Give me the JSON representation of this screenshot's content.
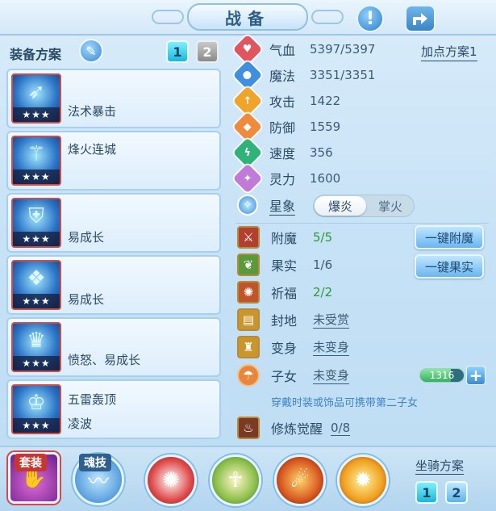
{
  "header": {
    "title": "战备",
    "help_icon": "exclamation-icon",
    "share_icon": "share-icon"
  },
  "left": {
    "scheme_label": "装备方案",
    "scheme_tabs": [
      "1",
      "2"
    ],
    "equipment": [
      {
        "name": "法术暴击",
        "stars": "★★★",
        "icon": "bow-icon"
      },
      {
        "name": "烽火连城",
        "stars": "★★★",
        "icon": "staff-icon"
      },
      {
        "name": "易成长",
        "stars": "★★★",
        "icon": "armor-icon"
      },
      {
        "name": "易成长",
        "stars": "★★★",
        "icon": "boots-icon"
      },
      {
        "name": "愤怒、易成长",
        "stars": "★★★",
        "icon": "helmet-icon"
      },
      {
        "name": "五雷轰顶",
        "name2": "凌波",
        "stars": "★★★",
        "icon": "crown-icon"
      }
    ]
  },
  "stats": {
    "addpoint_label": "加点方案1",
    "items": [
      {
        "name": "气血",
        "value": "5397/5397",
        "color": "#e0555e",
        "glyph": "♥"
      },
      {
        "name": "魔法",
        "value": "3351/3351",
        "color": "#3f8fe0",
        "glyph": "●"
      },
      {
        "name": "攻击",
        "value": "1422",
        "color": "#f0a42a",
        "glyph": "↑"
      },
      {
        "name": "防御",
        "value": "1559",
        "color": "#f08a3c",
        "glyph": "◆"
      },
      {
        "name": "速度",
        "value": "356",
        "color": "#2fb37a",
        "glyph": "ϟ"
      },
      {
        "name": "灵力",
        "value": "1600",
        "color": "#c27ad8",
        "glyph": "✦"
      }
    ],
    "star_label": "星象",
    "star_options": [
      "爆炎",
      "掌火"
    ]
  },
  "features": {
    "items": [
      {
        "name": "附魔",
        "value": "5/5",
        "style": "green",
        "color": "#b2402e",
        "glyph": "⚔"
      },
      {
        "name": "果实",
        "value": "1/6",
        "style": "plain",
        "color": "#5a9a3a",
        "glyph": "❦"
      },
      {
        "name": "祈福",
        "value": "2/2",
        "style": "green",
        "color": "#c0552a",
        "glyph": "✺"
      },
      {
        "name": "封地",
        "value": "未受赏",
        "style": "link",
        "color": "#c9962e",
        "glyph": "▤"
      },
      {
        "name": "变身",
        "value": "未变身",
        "style": "link",
        "color": "#c9962e",
        "glyph": "♜"
      },
      {
        "name": "子女",
        "value": "未变身",
        "style": "link",
        "color": "#e8873c",
        "glyph": "☂"
      }
    ],
    "enchant_button": "一键附魔",
    "fruit_button": "一键果实",
    "child_exp": "1316",
    "child_exp_ratio": 0.7,
    "hint": "穿戴时装或饰品可携带第二子女",
    "cultivation_label": "修炼觉醒",
    "cultivation_value": "0/8"
  },
  "bottom": {
    "suit_label": "套装",
    "soul_label": "魂技",
    "mount_label": "坐骑方案",
    "mount_tabs": [
      "1",
      "2"
    ]
  }
}
